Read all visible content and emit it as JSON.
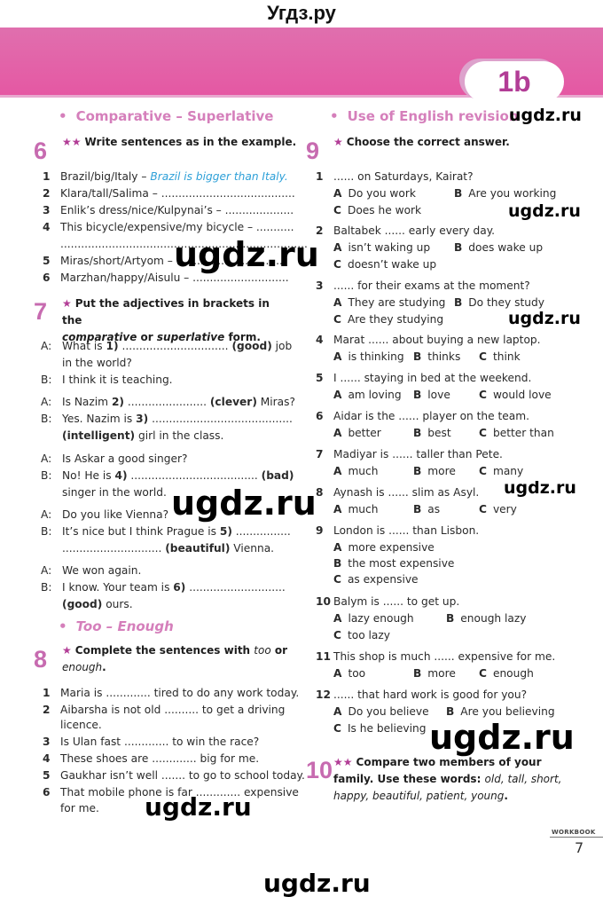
{
  "site_title": "Угдз.ру",
  "unit_badge": "1b",
  "colors": {
    "banner": "#e558a3",
    "accent": "#b23d96",
    "section_title": "#d57fbb",
    "example": "#2ea0d8"
  },
  "sections": {
    "comparative": "Comparative – Superlative",
    "too_enough": "Too – Enough",
    "use_of_english": "Use of English revision"
  },
  "ex6": {
    "num": "6",
    "stars": "★★",
    "instruction": "Write sentences as in the example.",
    "items": [
      {
        "n": "1",
        "text": "Brazil/big/Italy – ",
        "example": "Brazil is bigger than Italy."
      },
      {
        "n": "2",
        "text": "Klara/tall/Salima – ......................................."
      },
      {
        "n": "3",
        "text": "Enlik’s dress/nice/Kulpynai’s – ...................."
      },
      {
        "n": "4",
        "text": "This bicycle/expensive/my bicycle – ..........."
      },
      {
        "n": "",
        "text": "........................................................................"
      },
      {
        "n": "5",
        "text": "Miras/short/Artyom – ................................"
      },
      {
        "n": "6",
        "text": "Marzhan/happy/Aisulu – ............................"
      }
    ]
  },
  "ex7": {
    "num": "7",
    "stars": "★",
    "instruction_1": "Put the adjectives in brackets in the",
    "instruction_2a": "comparative",
    "instruction_2b": " or ",
    "instruction_2c": "superlative",
    "instruction_2d": " form.",
    "lines": [
      {
        "s": "A:",
        "pre": "What is ",
        "b": "1)",
        "mid": " ............................... ",
        "adj": "(good)",
        "post": " job"
      },
      {
        "s": "",
        "pre": "in the world?"
      },
      {
        "s": "B:",
        "pre": "I think it is teaching."
      },
      {
        "s": "A:",
        "pre": "Is Nazim ",
        "b": "2)",
        "mid": " ....................... ",
        "adj": "(clever)",
        "post": " Miras?"
      },
      {
        "s": "B:",
        "pre": "Yes. Nazim is ",
        "b": "3)",
        "mid": " ........................................."
      },
      {
        "s": "",
        "adj": "(intelligent)",
        "post": " girl in the class."
      },
      {
        "s": "A:",
        "pre": "Is Askar a good singer?"
      },
      {
        "s": "B:",
        "pre": "No! He is ",
        "b": "4)",
        "mid": " ..................................... ",
        "adj": "(bad)"
      },
      {
        "s": "",
        "pre": "singer in the world."
      },
      {
        "s": "A:",
        "pre": "Do you like Vienna?"
      },
      {
        "s": "B:",
        "pre": "It’s nice but I think Prague is ",
        "b": "5)",
        "mid": " ................"
      },
      {
        "s": "",
        "pre": "............................. ",
        "adj": "(beautiful)",
        "post": " Vienna."
      },
      {
        "s": "A:",
        "pre": "We won again."
      },
      {
        "s": "B:",
        "pre": "I know. Your team is ",
        "b": "6)",
        "mid": " ............................"
      },
      {
        "s": "",
        "adj": "(good)",
        "post": " ours."
      }
    ]
  },
  "ex8": {
    "num": "8",
    "stars": "★",
    "instruction_a": "Complete the sentences with ",
    "instruction_b": "too",
    "instruction_c": " or",
    "instruction_d": "enough",
    "instruction_e": ".",
    "items": [
      {
        "n": "1",
        "text": "Maria is ............. tired to do any work today."
      },
      {
        "n": "2",
        "text": "Aibarsha is not old .......... to get a driving"
      },
      {
        "n": "",
        "text": "licence."
      },
      {
        "n": "3",
        "text": "Is Ulan fast ............. to win the race?"
      },
      {
        "n": "4",
        "text": "These shoes are ............. big for me."
      },
      {
        "n": "5",
        "text": "Gaukhar isn’t well ....... to go to school today."
      },
      {
        "n": "6",
        "text": "That mobile phone is far ............. expensive"
      },
      {
        "n": "",
        "text": "for me."
      }
    ]
  },
  "ex9": {
    "num": "9",
    "stars": "★",
    "instruction": "Choose the correct answer.",
    "questions": [
      {
        "n": "1",
        "q": "...... on Saturdays, Kairat?",
        "A": "Do you work",
        "B": "Are you working",
        "C": "Does he work"
      },
      {
        "n": "2",
        "q": "Baltabek ...... early every day.",
        "A": "isn’t waking up",
        "B": "does wake up",
        "C": "doesn’t wake up"
      },
      {
        "n": "3",
        "q": "...... for their exams at the moment?",
        "A": "They are studying",
        "B": "Do they study",
        "C": "Are they studying"
      },
      {
        "n": "4",
        "q": "Marat ...... about buying a new laptop.",
        "A": "is thinking",
        "B": "thinks",
        "C": "think"
      },
      {
        "n": "5",
        "q": "I ...... staying in bed at the weekend.",
        "A": "am loving",
        "B": "love",
        "C": "would love"
      },
      {
        "n": "6",
        "q": "Aidar is the ...... player on the team.",
        "A": "better",
        "B": "best",
        "C": "better than"
      },
      {
        "n": "7",
        "q": "Madiyar is ...... taller than Pete.",
        "A": "much",
        "B": "more",
        "C": "many"
      },
      {
        "n": "8",
        "q": "Aynash is ...... slim as Asyl.",
        "A": "much",
        "B": "as",
        "C": "very"
      },
      {
        "n": "9",
        "q": "London is ...... than Lisbon.",
        "A": "more expensive",
        "B": "the most expensive",
        "C": "as expensive"
      },
      {
        "n": "10",
        "q": "Balym is ...... to get up.",
        "A": "lazy enough",
        "B": "enough lazy",
        "C": "too lazy"
      },
      {
        "n": "11",
        "q": "This shop is much ...... expensive for me.",
        "A": "too",
        "B": "more",
        "C": "enough"
      },
      {
        "n": "12",
        "q": "...... that hard work is good for you?",
        "A": "Do you believe",
        "B": "Are you believing",
        "C": "Is he believing"
      }
    ]
  },
  "ex10": {
    "num": "10",
    "stars": "★★",
    "instruction_a": "Compare two members of your",
    "instruction_b": "family. Use these words: ",
    "words_1": "old, tall, short,",
    "words_2": "happy, beautiful, patient, young",
    "instruction_end": "."
  },
  "footer": {
    "label": "WORKBOOK",
    "page": "7"
  },
  "watermark": "ugdz.ru"
}
